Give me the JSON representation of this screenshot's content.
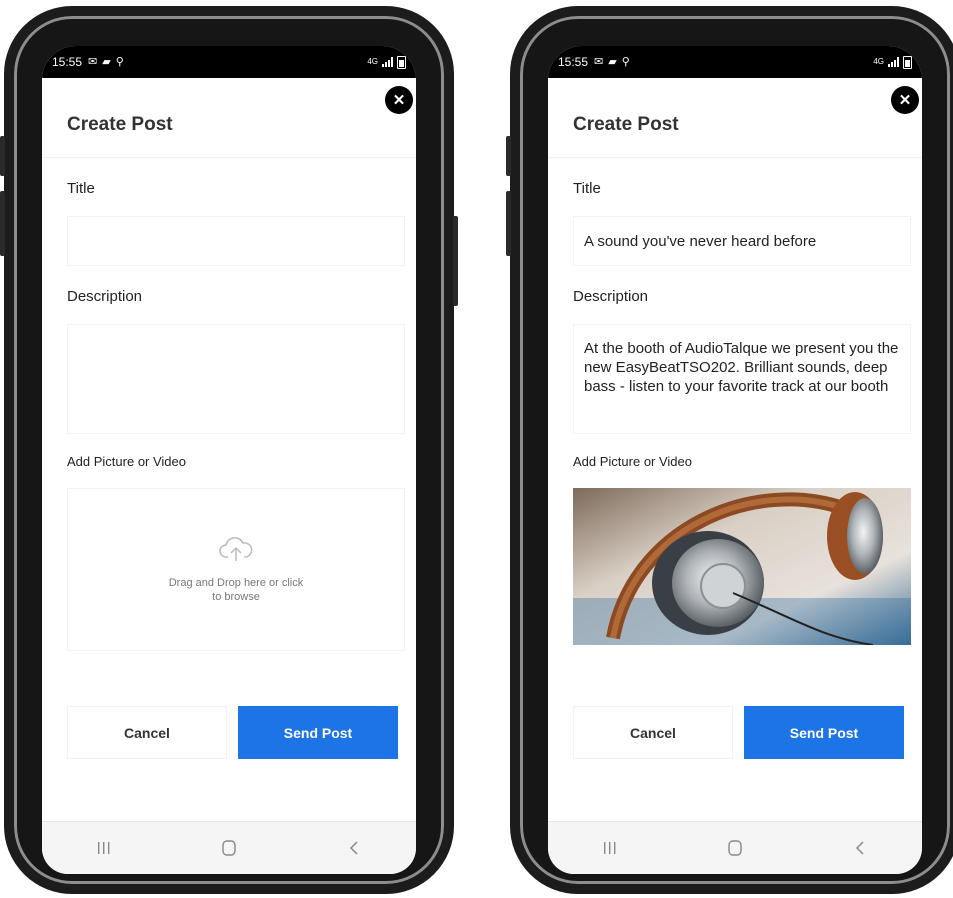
{
  "statusbar": {
    "time": "15:55",
    "network": "4G"
  },
  "screens": [
    {
      "page_title": "Create Post",
      "title_label": "Title",
      "title_value": "",
      "description_label": "Description",
      "description_value": "",
      "media_label": "Add Picture or Video",
      "upload_text": "Drag and Drop here or click to browse",
      "cancel_label": "Cancel",
      "send_label": "Send Post"
    },
    {
      "page_title": "Create Post",
      "title_label": "Title",
      "title_value": "A sound you've never heard before",
      "description_label": "Description",
      "description_value": "At the booth of AudioTalque we present you the new EasyBeatTSO202. Brilliant sounds, deep bass - listen to your favorite track at our booth",
      "media_label": "Add Picture or Video",
      "media_image": "headphones-photo",
      "cancel_label": "Cancel",
      "send_label": "Send Post"
    }
  ],
  "icons": {
    "close": "close-icon",
    "upload": "cloud-upload-icon",
    "nav_recent": "recent-apps-icon",
    "nav_home": "home-icon",
    "nav_back": "back-icon"
  },
  "colors": {
    "accent": "#1d74e6",
    "close_bg": "#000000"
  }
}
